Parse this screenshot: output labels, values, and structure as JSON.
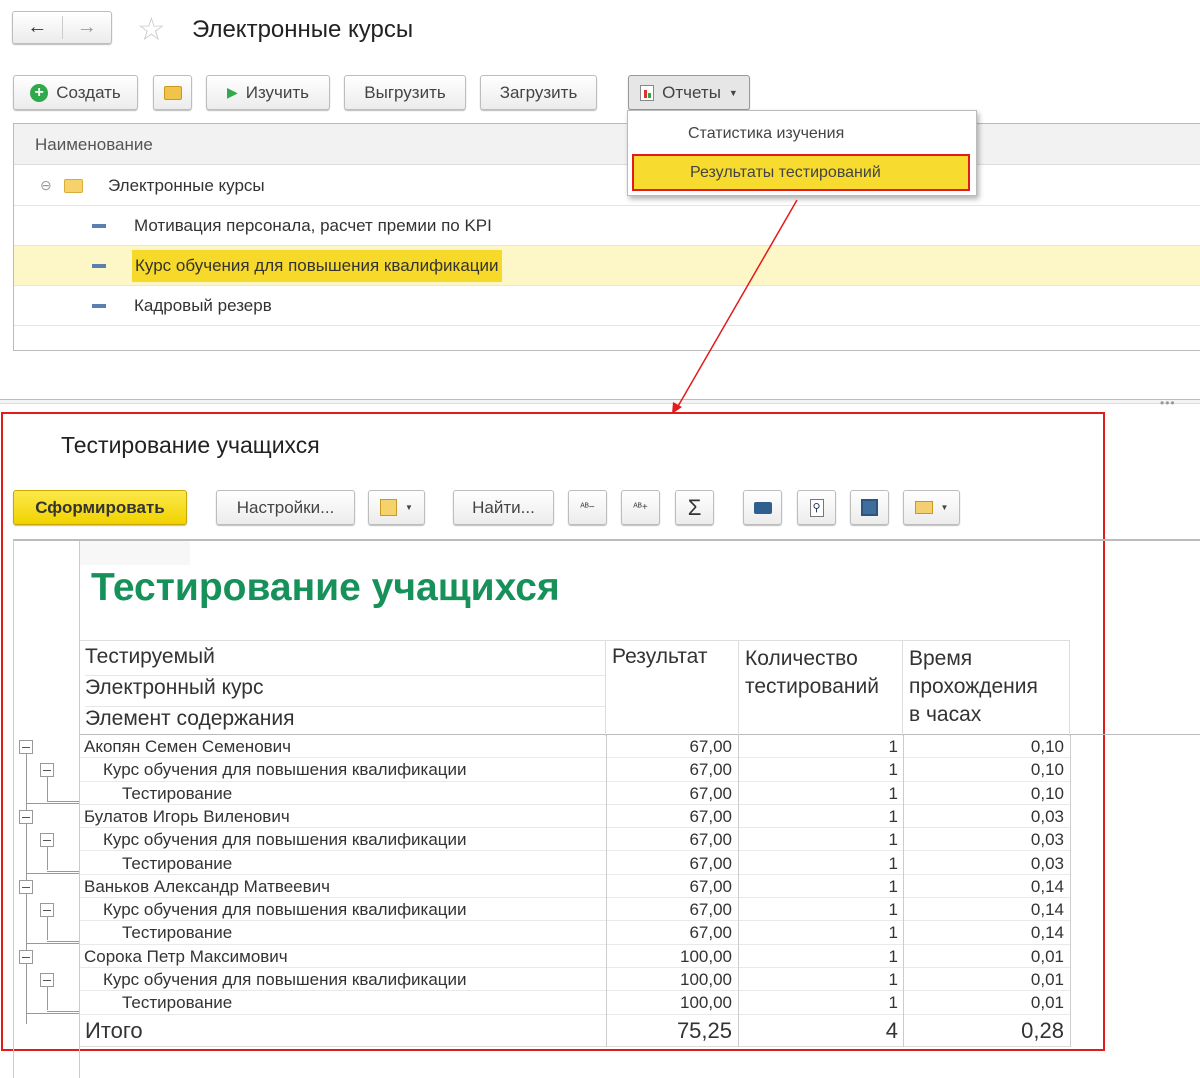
{
  "window": {
    "title": "Электронные курсы"
  },
  "toolbar": {
    "create": "Создать",
    "study": "Изучить",
    "export": "Выгрузить",
    "import": "Загрузить",
    "reports": "Отчеты"
  },
  "list": {
    "header": "Наименование",
    "group": "Электронные курсы",
    "items": [
      "Мотивация персонала, расчет премии по KPI",
      "Курс обучения для повышения квалификации",
      "Кадровый резерв"
    ]
  },
  "reports_menu": {
    "items": [
      "Статистика изучения",
      "Результаты тестирований"
    ]
  },
  "report_window": {
    "title": "Тестирование учащихся",
    "generate": "Сформировать",
    "settings": "Настройки...",
    "find": "Найти..."
  },
  "report": {
    "title": "Тестирование учащихся",
    "headers": {
      "col1": [
        "Тестируемый",
        "Электронный курс",
        "Элемент содержания"
      ],
      "col2": "Результат",
      "col3": [
        "Количество",
        "тестирований"
      ],
      "col4": [
        "Время",
        "прохождения",
        "в часах"
      ]
    },
    "rows": [
      {
        "level": 0,
        "name": "Акопян Семен Семенович",
        "result": "67,00",
        "count": "1",
        "time": "0,10"
      },
      {
        "level": 1,
        "name": "Курс обучения для повышения квалификации",
        "result": "67,00",
        "count": "1",
        "time": "0,10"
      },
      {
        "level": 2,
        "name": "Тестирование",
        "result": "67,00",
        "count": "1",
        "time": "0,10"
      },
      {
        "level": 0,
        "name": "Булатов Игорь Виленович",
        "result": "67,00",
        "count": "1",
        "time": "0,03"
      },
      {
        "level": 1,
        "name": "Курс обучения для повышения квалификации",
        "result": "67,00",
        "count": "1",
        "time": "0,03"
      },
      {
        "level": 2,
        "name": "Тестирование",
        "result": "67,00",
        "count": "1",
        "time": "0,03"
      },
      {
        "level": 0,
        "name": "Ваньков Александр Матвеевич",
        "result": "67,00",
        "count": "1",
        "time": "0,14"
      },
      {
        "level": 1,
        "name": "Курс обучения для повышения квалификации",
        "result": "67,00",
        "count": "1",
        "time": "0,14"
      },
      {
        "level": 2,
        "name": "Тестирование",
        "result": "67,00",
        "count": "1",
        "time": "0,14"
      },
      {
        "level": 0,
        "name": "Сорока Петр Максимович",
        "result": "100,00",
        "count": "1",
        "time": "0,01"
      },
      {
        "level": 1,
        "name": "Курс обучения для повышения квалификации",
        "result": "100,00",
        "count": "1",
        "time": "0,01"
      },
      {
        "level": 2,
        "name": "Тестирование",
        "result": "100,00",
        "count": "1",
        "time": "0,01"
      }
    ],
    "total": {
      "label": "Итого",
      "result": "75,25",
      "count": "4",
      "time": "0,28"
    }
  }
}
